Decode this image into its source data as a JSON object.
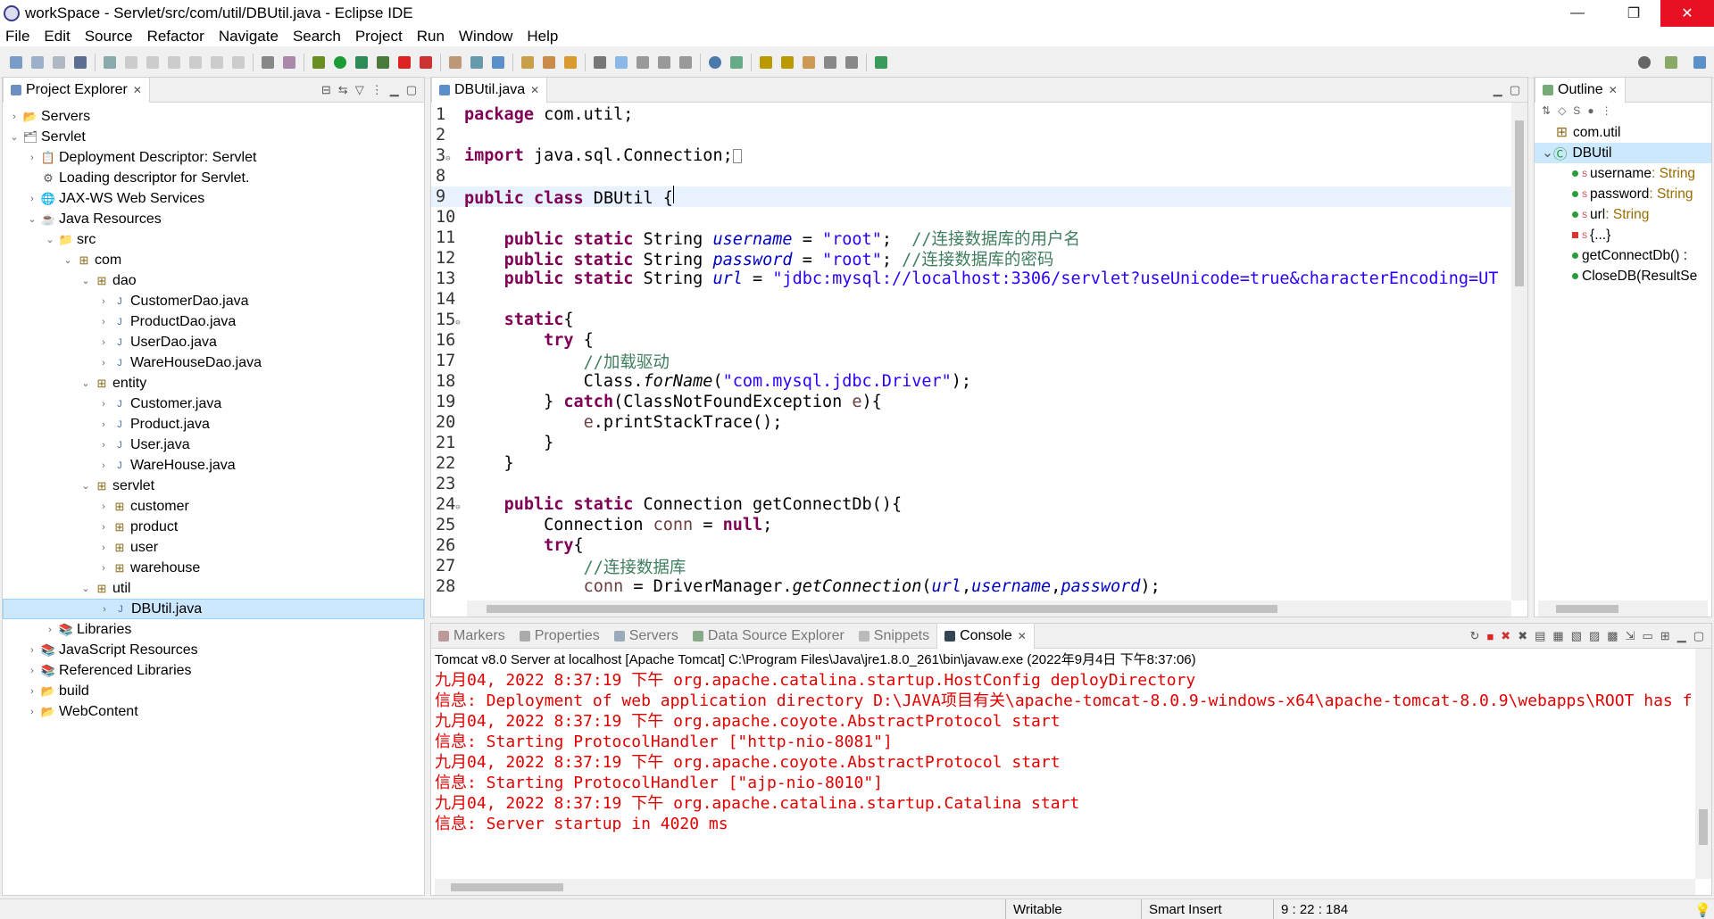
{
  "window": {
    "title": "workSpace - Servlet/src/com/util/DBUtil.java - Eclipse IDE",
    "minimize": "—",
    "restore": "❐",
    "close": "✕"
  },
  "menu": [
    "File",
    "Edit",
    "Source",
    "Refactor",
    "Navigate",
    "Search",
    "Project",
    "Run",
    "Window",
    "Help"
  ],
  "project_explorer": {
    "tab_label": "Project Explorer",
    "items": [
      {
        "label": "Servers",
        "twisty": "›",
        "icon": "folder-icon"
      },
      {
        "label": "Servlet",
        "twisty": "⌄",
        "icon": "web-project-icon"
      },
      {
        "label": "Deployment Descriptor: Servlet",
        "twisty": "›",
        "icon": "descriptor-icon"
      },
      {
        "label": "Loading descriptor for Servlet.",
        "twisty": "",
        "icon": "loading-icon"
      },
      {
        "label": "JAX-WS Web Services",
        "twisty": "›",
        "icon": "webservice-icon"
      },
      {
        "label": "Java Resources",
        "twisty": "⌄",
        "icon": "java-resources-icon"
      },
      {
        "label": "src",
        "twisty": "⌄",
        "icon": "source-folder-icon"
      },
      {
        "label": "com",
        "twisty": "⌄",
        "icon": "package-icon"
      },
      {
        "label": "dao",
        "twisty": "⌄",
        "icon": "package-icon"
      },
      {
        "label": "CustomerDao.java",
        "twisty": "›",
        "icon": "java-file-icon"
      },
      {
        "label": "ProductDao.java",
        "twisty": "›",
        "icon": "java-file-icon"
      },
      {
        "label": "UserDao.java",
        "twisty": "›",
        "icon": "java-file-icon"
      },
      {
        "label": "WareHouseDao.java",
        "twisty": "›",
        "icon": "java-file-icon"
      },
      {
        "label": "entity",
        "twisty": "⌄",
        "icon": "package-icon"
      },
      {
        "label": "Customer.java",
        "twisty": "›",
        "icon": "java-file-icon"
      },
      {
        "label": "Product.java",
        "twisty": "›",
        "icon": "java-file-icon"
      },
      {
        "label": "User.java",
        "twisty": "›",
        "icon": "java-file-icon"
      },
      {
        "label": "WareHouse.java",
        "twisty": "›",
        "icon": "java-file-icon"
      },
      {
        "label": "servlet",
        "twisty": "⌄",
        "icon": "package-icon"
      },
      {
        "label": "customer",
        "twisty": "›",
        "icon": "package-icon"
      },
      {
        "label": "product",
        "twisty": "›",
        "icon": "package-icon"
      },
      {
        "label": "user",
        "twisty": "›",
        "icon": "package-icon"
      },
      {
        "label": "warehouse",
        "twisty": "›",
        "icon": "package-icon"
      },
      {
        "label": "util",
        "twisty": "⌄",
        "icon": "package-icon"
      },
      {
        "label": "DBUtil.java",
        "twisty": "›",
        "icon": "java-file-icon"
      },
      {
        "label": "Libraries",
        "twisty": "›",
        "icon": "library-icon"
      },
      {
        "label": "JavaScript Resources",
        "twisty": "›",
        "icon": "library-icon"
      },
      {
        "label": "Referenced Libraries",
        "twisty": "›",
        "icon": "library-icon"
      },
      {
        "label": "build",
        "twisty": "›",
        "icon": "folder-icon"
      },
      {
        "label": "WebContent",
        "twisty": "›",
        "icon": "folder-icon"
      }
    ]
  },
  "editor": {
    "tab_label": "DBUtil.java",
    "lines": [
      {
        "n": "1",
        "html": "<span class='kw'>package</span> com.util;"
      },
      {
        "n": "2",
        "html": ""
      },
      {
        "n": "3",
        "html": "<span class='kw'>import</span> java.sql.Connection;<span style='border:1px solid #888;display:inline-block;width:10px;height:16px;vertical-align:middle'></span>"
      },
      {
        "n": "8",
        "html": ""
      },
      {
        "n": "9",
        "html": "<span class='kw'>public</span> <span class='kw'>class</span> DBUtil {"
      },
      {
        "n": "10",
        "html": ""
      },
      {
        "n": "11",
        "html": "    <span class='kw'>public</span> <span class='kw'>static</span> String <span class='fld'>username</span> = <span class='str'>\"root\"</span>;  <span class='cm'>//连接数据库的用户名</span>"
      },
      {
        "n": "12",
        "html": "    <span class='kw'>public</span> <span class='kw'>static</span> String <span class='fld'>password</span> = <span class='str'>\"root\"</span>; <span class='cm'>//连接数据库的密码</span>"
      },
      {
        "n": "13",
        "html": "    <span class='kw'>public</span> <span class='kw'>static</span> String <span class='fld'>url</span> = <span class='str'>\"jdbc:mysql://localhost:3306/servlet?useUnicode=true&amp;characterEncoding=UT</span>"
      },
      {
        "n": "14",
        "html": ""
      },
      {
        "n": "15",
        "html": "    <span class='kw'>static</span>{"
      },
      {
        "n": "16",
        "html": "        <span class='kw'>try</span> {"
      },
      {
        "n": "17",
        "html": "            <span class='cm'>//加载驱动</span>"
      },
      {
        "n": "18",
        "html": "            Class.<span class='st'>forName</span>(<span class='str'>\"com.mysql.jdbc.Driver\"</span>);"
      },
      {
        "n": "19",
        "html": "        } <span class='kw'>catch</span>(ClassNotFoundException <span class='vr'>e</span>){"
      },
      {
        "n": "20",
        "html": "            <span class='vr'>e</span>.printStackTrace();"
      },
      {
        "n": "21",
        "html": "        }"
      },
      {
        "n": "22",
        "html": "    }"
      },
      {
        "n": "23",
        "html": ""
      },
      {
        "n": "24",
        "html": "    <span class='kw'>public</span> <span class='kw'>static</span> Connection getConnectDb(){"
      },
      {
        "n": "25",
        "html": "        Connection <span class='vr'>conn</span> = <span class='kw'>null</span>;"
      },
      {
        "n": "26",
        "html": "        <span class='kw'>try</span>{"
      },
      {
        "n": "27",
        "html": "            <span class='cm'>//连接数据库</span>"
      },
      {
        "n": "28",
        "html": "            <span class='vr'>conn</span> = DriverManager.<span class='st'>getConnection</span>(<span class='fld'>url</span>,<span class='fld'>username</span>,<span class='fld'>password</span>);"
      }
    ]
  },
  "outline": {
    "tab_label": "Outline",
    "items": [
      {
        "label": "com.util",
        "type": "",
        "kind": "package"
      },
      {
        "label": "DBUtil",
        "type": "",
        "kind": "class"
      },
      {
        "label": "username",
        "type": " : String",
        "kind": "field"
      },
      {
        "label": "password",
        "type": " : String",
        "kind": "field"
      },
      {
        "label": "url",
        "type": " : String",
        "kind": "field"
      },
      {
        "label": "{...}",
        "type": "",
        "kind": "static-block"
      },
      {
        "label": "getConnectDb() :",
        "type": "",
        "kind": "method"
      },
      {
        "label": "CloseDB(ResultSe",
        "type": "",
        "kind": "method"
      }
    ]
  },
  "bottom_tabs": [
    "Markers",
    "Properties",
    "Servers",
    "Data Source Explorer",
    "Snippets",
    "Console"
  ],
  "console": {
    "header": "Tomcat v8.0 Server at localhost [Apache Tomcat] C:\\Program Files\\Java\\jre1.8.0_261\\bin\\javaw.exe  (2022年9月4日 下午8:37:06)",
    "lines": [
      "九月04, 2022 8:37:19 下午 org.apache.catalina.startup.HostConfig deployDirectory",
      "信息: Deployment of web application directory D:\\JAVA项目有关\\apache-tomcat-8.0.9-windows-x64\\apache-tomcat-8.0.9\\webapps\\ROOT has f",
      "九月04, 2022 8:37:19 下午 org.apache.coyote.AbstractProtocol start",
      "信息: Starting ProtocolHandler [\"http-nio-8081\"]",
      "九月04, 2022 8:37:19 下午 org.apache.coyote.AbstractProtocol start",
      "信息: Starting ProtocolHandler [\"ajp-nio-8010\"]",
      "九月04, 2022 8:37:19 下午 org.apache.catalina.startup.Catalina start",
      "信息: Server startup in 4020 ms"
    ]
  },
  "status": {
    "writable": "Writable",
    "insert_mode": "Smart Insert",
    "position": "9 : 22 : 184"
  },
  "colors": {
    "accent": "#0078d7",
    "selection": "#cce8ff",
    "console_error": "#e00000"
  }
}
